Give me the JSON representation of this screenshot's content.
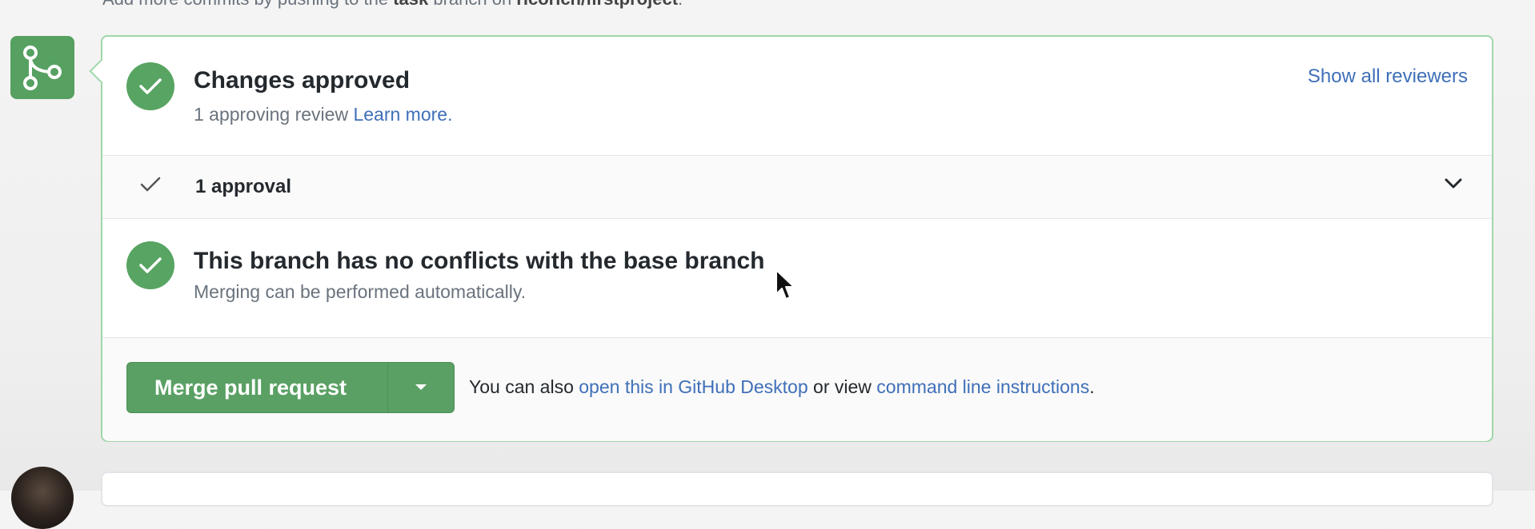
{
  "top_text": {
    "prefix": "Add more commits by pushing to the ",
    "branch": "task",
    "middle": " branch on ",
    "repo": "ricorich/firstproject",
    "suffix": "."
  },
  "reviews": {
    "title": "Changes approved",
    "subtitle": "1 approving review",
    "learn_more": "Learn more.",
    "show_all": "Show all reviewers"
  },
  "approvals": {
    "label": "1 approval"
  },
  "conflicts": {
    "title": "This branch has no conflicts with the base branch",
    "subtitle": "Merging can be performed automatically."
  },
  "merge": {
    "button_label": "Merge pull request",
    "also_text": "You can also ",
    "desktop_link": "open this in GitHub Desktop",
    "or_view": " or view ",
    "cli_link": "command line instructions",
    "period": "."
  },
  "colors": {
    "success": "#58a462",
    "link": "#3f6fb8",
    "panel_border": "#9fd7a9"
  },
  "icons": {
    "merge_badge": "git-merge-icon",
    "check": "check-icon",
    "chevron": "chevron-down-icon",
    "caret": "caret-down-icon",
    "cursor": "mouse-pointer-icon"
  }
}
